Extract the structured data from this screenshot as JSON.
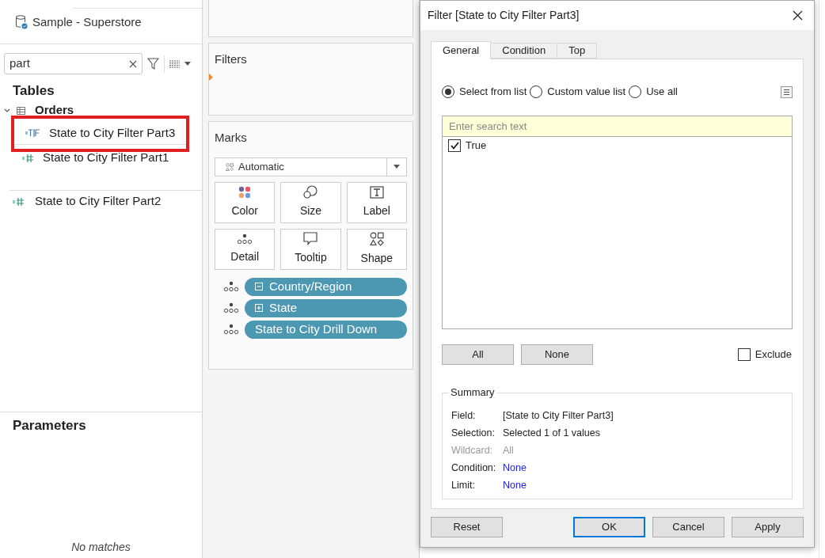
{
  "sidebar": {
    "data_source": "Sample - Superstore",
    "search": {
      "value": "part"
    },
    "tables_heading": "Tables",
    "tables": [
      {
        "name": "Orders",
        "expanded": true,
        "children": [
          {
            "name": "State to City Filter Part3",
            "kind": "boolean",
            "selected": true
          },
          {
            "name": "State to City Filter Part1",
            "kind": "number",
            "selected": false
          }
        ]
      }
    ],
    "loose_fields": [
      {
        "name": "State to City Filter Part2",
        "kind": "number"
      }
    ],
    "parameters_heading": "Parameters",
    "no_matches": "No matches"
  },
  "shelves": {
    "filters_title": "Filters",
    "marks_title": "Marks",
    "mark_type": "Automatic",
    "mark_cards": [
      {
        "label": "Color",
        "kind": "color"
      },
      {
        "label": "Size",
        "kind": "size"
      },
      {
        "label": "Label",
        "kind": "label"
      },
      {
        "label": "Detail",
        "kind": "detail"
      },
      {
        "label": "Tooltip",
        "kind": "tooltip"
      },
      {
        "label": "Shape",
        "kind": "shape"
      }
    ],
    "pills": [
      {
        "label": "Country/Region",
        "kind": "collapsible"
      },
      {
        "label": "State",
        "kind": "expandable"
      },
      {
        "label": "State to City Drill Down",
        "kind": "plain"
      }
    ]
  },
  "dialog": {
    "title": "Filter [State to City Filter Part3]",
    "tabs": [
      {
        "label": "General",
        "selected": true
      },
      {
        "label": "Condition",
        "selected": false
      },
      {
        "label": "Top",
        "selected": false
      }
    ],
    "modes": [
      {
        "label": "Select from list",
        "selected": true
      },
      {
        "label": "Custom value list",
        "selected": false
      },
      {
        "label": "Use all",
        "selected": false
      }
    ],
    "search": {
      "placeholder": "Enter search text"
    },
    "values": [
      {
        "label": "True",
        "checked": true
      }
    ],
    "list_buttons": [
      "All",
      "None"
    ],
    "exclude": {
      "label": "Exclude",
      "checked": false
    },
    "summary": {
      "title": "Summary",
      "rows": [
        {
          "label": "Field:",
          "value": "[State to City Filter Part3]",
          "kind": "text",
          "disabled": false
        },
        {
          "label": "Selection:",
          "value": "Selected 1 of 1 values",
          "kind": "text",
          "disabled": false
        },
        {
          "label": "Wildcard:",
          "value": "All",
          "kind": "text",
          "disabled": true
        },
        {
          "label": "Condition:",
          "value": "None",
          "kind": "link",
          "disabled": false
        },
        {
          "label": "Limit:",
          "value": "None",
          "kind": "link",
          "disabled": false
        }
      ]
    },
    "buttons": [
      {
        "label": "Reset",
        "focused": false
      },
      {
        "label": "OK",
        "focused": true
      },
      {
        "label": "Cancel",
        "focused": false
      },
      {
        "label": "Apply",
        "focused": false
      }
    ]
  }
}
